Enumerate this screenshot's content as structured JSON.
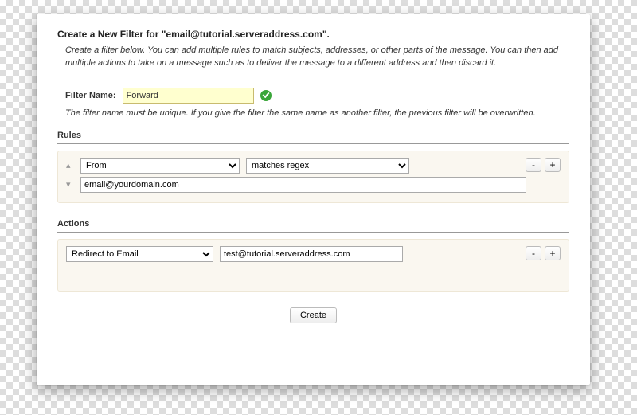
{
  "header": {
    "title": "Create a New Filter for \"email@tutorial.serveraddress.com\".",
    "intro": "Create a filter below. You can add multiple rules to match subjects, addresses, or other parts of the message. You can then add multiple actions to take on a message such as to deliver the message to a different address and then discard it."
  },
  "filter_name": {
    "label": "Filter Name:",
    "value": "Forward",
    "note": "The filter name must be unique. If you give the filter the same name as another filter, the previous filter will be overwritten."
  },
  "rules": {
    "title": "Rules",
    "subject": "From",
    "operator": "matches regex",
    "value": "email@yourdomain.com"
  },
  "actions": {
    "title": "Actions",
    "action": "Redirect to Email",
    "target": "test@tutorial.serveraddress.com"
  },
  "buttons": {
    "minus": "-",
    "plus": "+",
    "create": "Create"
  }
}
